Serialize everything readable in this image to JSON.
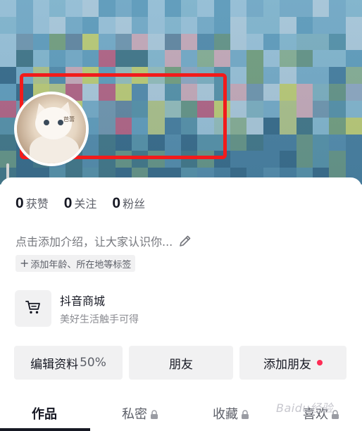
{
  "profile": {
    "avatar_label": "芭蕾"
  },
  "stats": [
    {
      "value": "0",
      "label": "获赞"
    },
    {
      "value": "0",
      "label": "关注"
    },
    {
      "value": "0",
      "label": "粉丝"
    }
  ],
  "intro": {
    "placeholder": "点击添加介绍，让大家认识你..."
  },
  "tag_chip": {
    "label": "添加年龄、所在地等标签"
  },
  "shop": {
    "title": "抖音商城",
    "subtitle": "美好生活触手可得",
    "icon": "cart-icon"
  },
  "actions": {
    "edit_profile": "编辑资料",
    "edit_progress": "50%",
    "friends": "朋友",
    "add_friends": "添加朋友"
  },
  "tabs": [
    {
      "label": "作品",
      "locked": false,
      "active": true
    },
    {
      "label": "私密",
      "locked": true,
      "active": false
    },
    {
      "label": "收藏",
      "locked": true,
      "active": false
    },
    {
      "label": "喜欢",
      "locked": true,
      "active": false
    }
  ],
  "watermark": "Baidu经验",
  "colors": {
    "highlight": "#f21b1b",
    "notification_dot": "#fe2c55",
    "text_primary": "#161823",
    "text_secondary": "#5c5f68",
    "chip_bg": "#f1f1f2"
  }
}
